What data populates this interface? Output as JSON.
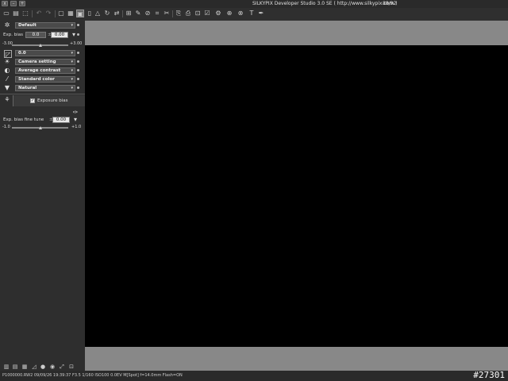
{
  "window": {
    "title": "SILKYPIX Developer Studio 3.0 SE ( http://www.silkypix.com )",
    "counter": "88/92",
    "close_glyph": "x",
    "minimize_glyph": "–",
    "maximize_glyph": "+"
  },
  "toolbar": {
    "icons": [
      "open-folder-icon",
      "save-icon",
      "export-icon",
      "undo-icon",
      "redo-icon",
      "view-single-icon",
      "view-thumb-icon",
      "view-combined-icon",
      "view-full-icon",
      "warning-icon",
      "rotate-icon",
      "grid-icon",
      "tools-icon",
      "flip-icon",
      "compare-icon",
      "crop-icon",
      "copy-icon",
      "paste-icon",
      "print-icon",
      "settings-icon",
      "develop-icon",
      "help-icon"
    ]
  },
  "panel": {
    "preset": "Default",
    "exposure": {
      "label": "Exp. bias",
      "value": "0.0",
      "value2": "0.00",
      "min": "-3.00",
      "max": "+3.00",
      "level": 0.5
    },
    "tone_value": "0.0",
    "white_balance": "Camera setting",
    "contrast": "Average contrast",
    "color": "Standard color",
    "style": "Natural",
    "exposure_bias_checkbox": {
      "label": "Exposure bias",
      "checked": true
    },
    "fine_tune": {
      "label": "Exp. bias fine tune",
      "value": "0.00",
      "min": "-1.0",
      "max": "+1.0",
      "level": 0.5
    }
  },
  "status": {
    "text": "P1000000.RW2  09/09/26 19:39:37  F3.5  1/160  ISO100  0.0EV  M[Spot]  f=14.0mm  Flash=ON"
  },
  "watermark": "#27301",
  "colors": {
    "background": "#2b2b2b",
    "viewer": "#000000",
    "viewer_margin": "#888888"
  }
}
